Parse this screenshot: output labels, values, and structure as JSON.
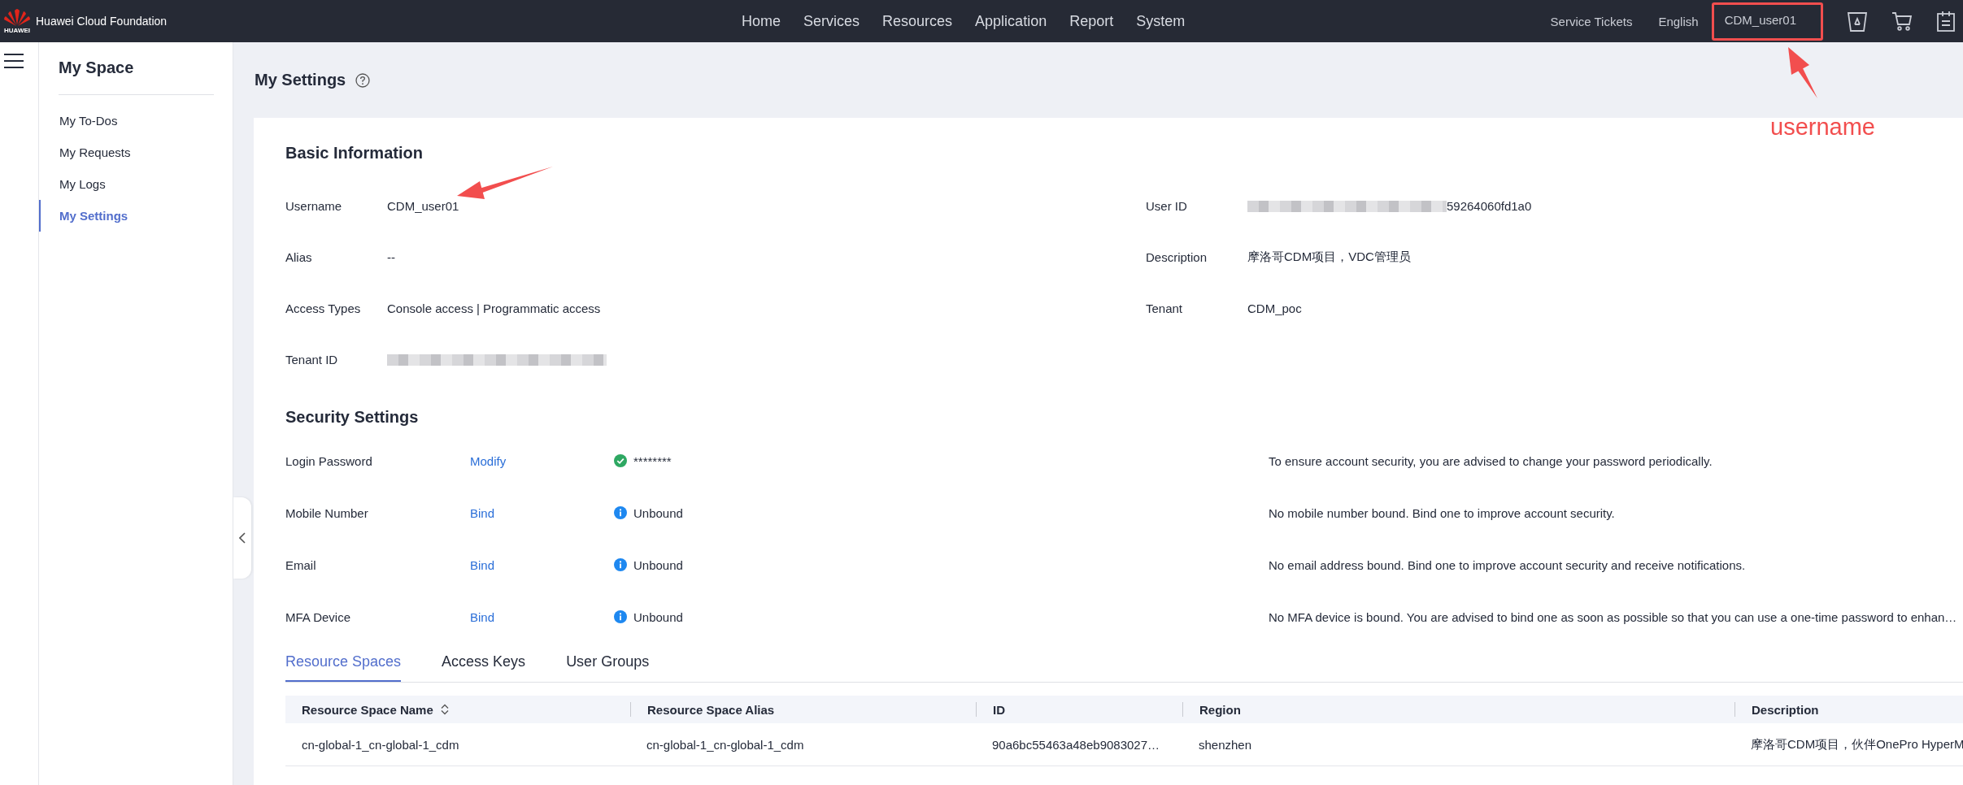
{
  "header": {
    "logo_text": "HUAWEI",
    "brand": "Huawei Cloud Foundation",
    "nav": [
      {
        "label": "Home"
      },
      {
        "label": "Services"
      },
      {
        "label": "Resources"
      },
      {
        "label": "Application"
      },
      {
        "label": "Report"
      },
      {
        "label": "System"
      }
    ],
    "links": [
      {
        "label": "Service Tickets"
      },
      {
        "label": "English"
      }
    ],
    "user": {
      "label": "CDM_user01",
      "highlighted": true
    }
  },
  "sidebar": {
    "title": "My Space",
    "items": [
      {
        "label": "My To-Dos",
        "selected": false
      },
      {
        "label": "My Requests",
        "selected": false
      },
      {
        "label": "My Logs",
        "selected": false
      },
      {
        "label": "My Settings",
        "selected": true
      }
    ]
  },
  "page": {
    "title": "My Settings"
  },
  "basic_info": {
    "title": "Basic Information",
    "fields": [
      {
        "label": "Username",
        "value": "CDM_user01",
        "redacted": false
      },
      {
        "label": "User ID",
        "value": "59264060fd1a0",
        "redacted": true
      },
      {
        "label": "Alias",
        "value": "--",
        "redacted": false
      },
      {
        "label": "Description",
        "value": "摩洛哥CDM项目，VDC管理员",
        "redacted": false
      },
      {
        "label": "Access Types",
        "value": "Console access | Programmatic access",
        "redacted": false
      },
      {
        "label": "Tenant",
        "value": "CDM_poc",
        "redacted": false
      },
      {
        "label": "Tenant ID",
        "redacted": true
      }
    ]
  },
  "security": {
    "title": "Security Settings",
    "rows": [
      {
        "label": "Login Password",
        "action": "Modify",
        "kind": "ok",
        "status_text": "********",
        "hint": "To ensure account security, you are advised to change your password periodically."
      },
      {
        "label": "Mobile Number",
        "action": "Bind",
        "kind": "info",
        "status_text": "Unbound",
        "hint": "No mobile number bound. Bind one to improve account security."
      },
      {
        "label": "Email",
        "action": "Bind",
        "kind": "info",
        "status_text": "Unbound",
        "hint": "No email address bound. Bind one to improve account security and receive notifications."
      },
      {
        "label": "MFA Device",
        "action": "Bind",
        "kind": "info",
        "status_text": "Unbound",
        "hint": "No MFA device is bound. You are advised to bind one as soon as possible so that you can use a one-time password to enhan…"
      }
    ]
  },
  "tabs": [
    {
      "label": "Resource Spaces",
      "selected": true
    },
    {
      "label": "Access Keys",
      "selected": false
    },
    {
      "label": "User Groups",
      "selected": false
    }
  ],
  "table": {
    "columns": [
      {
        "label": "Resource Space Name",
        "sortable": true
      },
      {
        "label": "Resource Space Alias",
        "sortable": false
      },
      {
        "label": "ID",
        "sortable": false
      },
      {
        "label": "Region",
        "sortable": false
      },
      {
        "label": "Description",
        "sortable": false
      }
    ],
    "rows": [
      [
        "cn-global-1_cn-global-1_cdm",
        "cn-global-1_cn-global-1_cdm",
        "90a6bc55463a48eb9083027…",
        "shenzhen",
        "摩洛哥CDM项目，伙伴OnePro HyperM"
      ]
    ]
  },
  "annotation": {
    "label": "username"
  }
}
